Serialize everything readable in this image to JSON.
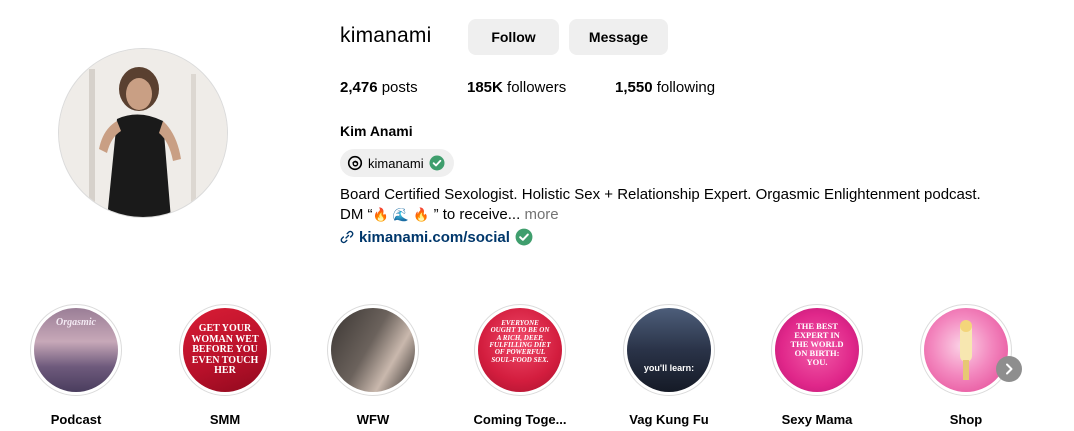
{
  "profile": {
    "username": "kimanami",
    "follow_label": "Follow",
    "message_label": "Message",
    "posts_count": "2,476",
    "posts_label": "posts",
    "followers_count": "185K",
    "followers_label": "followers",
    "following_count": "1,550",
    "following_label": "following",
    "full_name": "Kim Anami",
    "threads_handle": "kimanami",
    "bio_line1": "Board Certified Sexologist. Holistic Sex + Relationship Expert. Orgasmic Enlightenment podcast.",
    "bio_line2_start": "DM “",
    "bio_line2_end": " ” to receive...",
    "bio_emojis": [
      "🔥",
      "🌊",
      "🔥"
    ],
    "more_label": "more",
    "link": "kimanami.com/social"
  },
  "highlights": [
    {
      "label": "Podcast",
      "cover_text": "Orgasmic"
    },
    {
      "label": "SMM",
      "cover_text": "GET YOUR WOMAN WET BEFORE YOU EVEN TOUCH HER"
    },
    {
      "label": "WFW",
      "cover_text": ""
    },
    {
      "label": "Coming Toge...",
      "cover_text": "EVERYONE OUGHT TO BE ON A RICH, DEEP, FULFILLING DIET OF POWERFUL SOUL-FOOD SEX."
    },
    {
      "label": "Vag Kung Fu",
      "cover_text": "you'll learn:"
    },
    {
      "label": "Sexy Mama",
      "cover_text": "THE BEST EXPERT IN THE WORLD ON BIRTH: YOU."
    },
    {
      "label": "Shop",
      "cover_text": ""
    }
  ],
  "colors": {
    "button_bg": "#efefef",
    "link": "#00376b",
    "verified": "#3f9e6d",
    "muted": "#737373"
  }
}
